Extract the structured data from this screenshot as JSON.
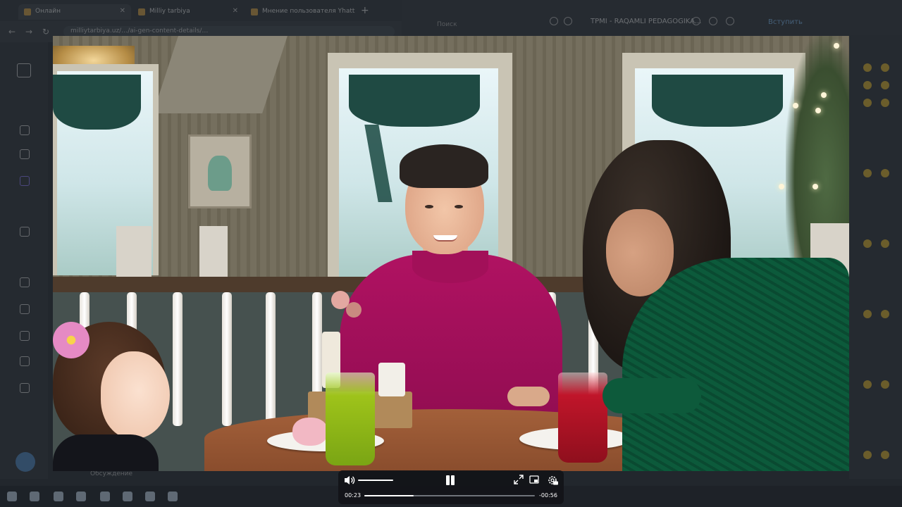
{
  "browser": {
    "tabs": [
      {
        "label": "Онлайн"
      },
      {
        "label": "Milliy tarbiya"
      },
      {
        "label": "Мнение пользователя Yhatt"
      }
    ],
    "url": "milliytarbiya.uz/…/ai-gen-content-details/…"
  },
  "messenger": {
    "search_placeholder": "Поиск",
    "chat_title": "TPMI - RAQAMLI PEDAGOGIKA...",
    "chat_subtitle": "",
    "join_label": "Вступить",
    "footer_label": "Обсуждение"
  },
  "player": {
    "current_time": "00:23",
    "remaining_time": "-00:56",
    "progress_fraction": 0.29,
    "volume_fraction": 1.0
  },
  "icons": {
    "volume": "volume-icon",
    "pause": "pause-icon",
    "fullscreen": "fullscreen-icon",
    "pip": "picture-in-picture-icon",
    "settings": "settings-icon"
  },
  "colors": {
    "control_bar": "#121418",
    "shirt": "#b01262",
    "dress": "#0c5a3b"
  }
}
